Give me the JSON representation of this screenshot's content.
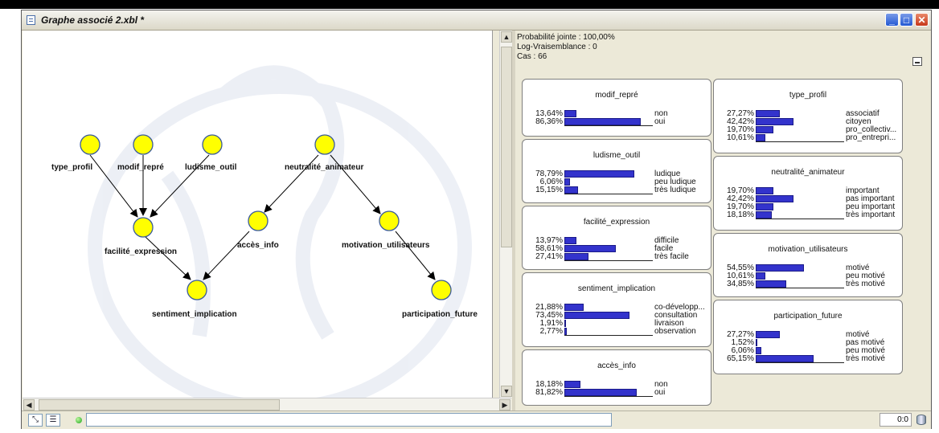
{
  "window": {
    "title": "Graphe associé 2.xbl *",
    "minimize": "_",
    "maximize": "□",
    "close": "✕"
  },
  "stats": {
    "joint_probability": "Probabilité jointe : 100,00%",
    "log_likelihood": "Log-Vraisemblance : 0",
    "cases": "Cas : 66"
  },
  "graph": {
    "nodes": {
      "type_profil": "type_profil",
      "modif_repre": "modif_repré",
      "ludisme_outil": "ludisme_outil",
      "neutralite_animateur": "neutralité_animateur",
      "facilite_expression": "facilité_expression",
      "acces_info": "accès_info",
      "motivation_utilisateurs": "motivation_utilisateurs",
      "sentiment_implication": "sentiment_implication",
      "participation_future": "participation_future"
    }
  },
  "monitors": [
    {
      "title": "modif_repré",
      "rows": [
        {
          "pct": "13,64%",
          "value": 13.64,
          "state": "non"
        },
        {
          "pct": "86,36%",
          "value": 86.36,
          "state": "oui"
        }
      ]
    },
    {
      "title": "ludisme_outil",
      "rows": [
        {
          "pct": "78,79%",
          "value": 78.79,
          "state": "ludique"
        },
        {
          "pct": "6,06%",
          "value": 6.06,
          "state": "peu ludique"
        },
        {
          "pct": "15,15%",
          "value": 15.15,
          "state": "très ludique"
        }
      ]
    },
    {
      "title": "facilité_expression",
      "rows": [
        {
          "pct": "13,97%",
          "value": 13.97,
          "state": "difficile"
        },
        {
          "pct": "58,61%",
          "value": 58.61,
          "state": "facile"
        },
        {
          "pct": "27,41%",
          "value": 27.41,
          "state": "très facile"
        }
      ]
    },
    {
      "title": "sentiment_implication",
      "rows": [
        {
          "pct": "21,88%",
          "value": 21.88,
          "state": "co-développ..."
        },
        {
          "pct": "73,45%",
          "value": 73.45,
          "state": "consultation"
        },
        {
          "pct": "1,91%",
          "value": 1.91,
          "state": "livraison"
        },
        {
          "pct": "2,77%",
          "value": 2.77,
          "state": "observation"
        }
      ]
    },
    {
      "title": "accès_info",
      "rows": [
        {
          "pct": "18,18%",
          "value": 18.18,
          "state": "non"
        },
        {
          "pct": "81,82%",
          "value": 81.82,
          "state": "oui"
        }
      ]
    },
    {
      "title": "type_profil",
      "rows": [
        {
          "pct": "27,27%",
          "value": 27.27,
          "state": "associatif"
        },
        {
          "pct": "42,42%",
          "value": 42.42,
          "state": "citoyen"
        },
        {
          "pct": "19,70%",
          "value": 19.7,
          "state": "pro_collectiv..."
        },
        {
          "pct": "10,61%",
          "value": 10.61,
          "state": "pro_entrepri..."
        }
      ]
    },
    {
      "title": "neutralité_animateur",
      "rows": [
        {
          "pct": "19,70%",
          "value": 19.7,
          "state": "important"
        },
        {
          "pct": "42,42%",
          "value": 42.42,
          "state": "pas important"
        },
        {
          "pct": "19,70%",
          "value": 19.7,
          "state": "peu important"
        },
        {
          "pct": "18,18%",
          "value": 18.18,
          "state": "très important"
        }
      ]
    },
    {
      "title": "motivation_utilisateurs",
      "rows": [
        {
          "pct": "54,55%",
          "value": 54.55,
          "state": "motivé"
        },
        {
          "pct": "10,61%",
          "value": 10.61,
          "state": "peu motivé"
        },
        {
          "pct": "34,85%",
          "value": 34.85,
          "state": "très motivé"
        }
      ]
    },
    {
      "title": "participation_future",
      "rows": [
        {
          "pct": "27,27%",
          "value": 27.27,
          "state": "motivé"
        },
        {
          "pct": "1,52%",
          "value": 1.52,
          "state": "pas motivé"
        },
        {
          "pct": "6,06%",
          "value": 6.06,
          "state": "peu motivé"
        },
        {
          "pct": "65,15%",
          "value": 65.15,
          "state": "très motivé"
        }
      ]
    }
  ],
  "statusbar": {
    "counter": "0:0",
    "input_value": ""
  },
  "icons": {
    "title": "document-icon",
    "arc_tool": "arc-tool-icon",
    "monitor_tool": "monitor-tool-icon",
    "status_light": "status-light-icon",
    "database": "database-icon"
  },
  "colors": {
    "node_fill": "#ffff00",
    "bar": "#3333cc"
  }
}
